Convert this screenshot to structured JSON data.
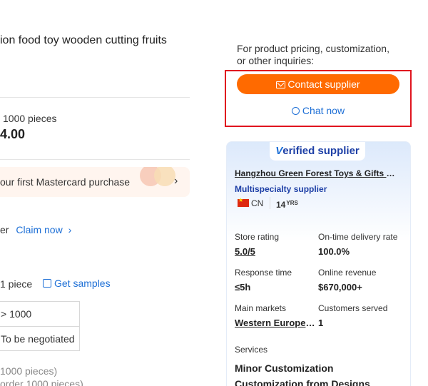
{
  "product": {
    "title": "ion food toy wooden cutting fruits",
    "moq": "1000 pieces",
    "price": "4.00",
    "promo_text": "our first Mastercard purchase",
    "promo_arrow": "›",
    "claim_prefix": "er",
    "claim_link": "Claim now",
    "claim_arrow": "›",
    "sample_qty": "1 piece",
    "sample_link": "Get samples",
    "tiers": [
      "> 1000",
      "To be negotiated"
    ],
    "note_1": "1000 pieces)",
    "note_2": "order 1000 pieces)"
  },
  "inquiry": {
    "prompt_line1": "For product pricing, customization,",
    "prompt_line2": "or other inquiries:",
    "contact_label": "Contact supplier",
    "chat_label": "Chat now"
  },
  "supplier": {
    "badge_v": "V",
    "badge_rest": "erified supplier",
    "name": "Hangzhou Green Forest Toys & Gifts Co., Ltd.",
    "type": "Multispecialty supplier",
    "country": "CN",
    "years": "14",
    "years_unit": "YRS",
    "stats": {
      "store_rating_label": "Store rating",
      "store_rating_value": "5.0/5",
      "ontime_label": "On-time delivery rate",
      "ontime_value": "100.0%",
      "response_label": "Response time",
      "response_value": "≤5h",
      "revenue_label": "Online revenue",
      "revenue_value": "$670,000+",
      "markets_label": "Main markets",
      "markets_value": "Western Europe, North America",
      "customers_label": "Customers served",
      "customers_value": "1"
    },
    "services_label": "Services",
    "services": [
      "Minor Customization",
      "Customization from Designs"
    ]
  },
  "colors": {
    "accent_orange": "#ff6a00",
    "link_blue": "#1d6fd6",
    "highlight_red": "#e0141e",
    "verified_navy": "#1d3fa6"
  },
  "icons": {
    "contact": "mail-icon",
    "chat": "chat-bubble-icon",
    "samples": "box-icon",
    "flag": "china-flag-icon"
  }
}
